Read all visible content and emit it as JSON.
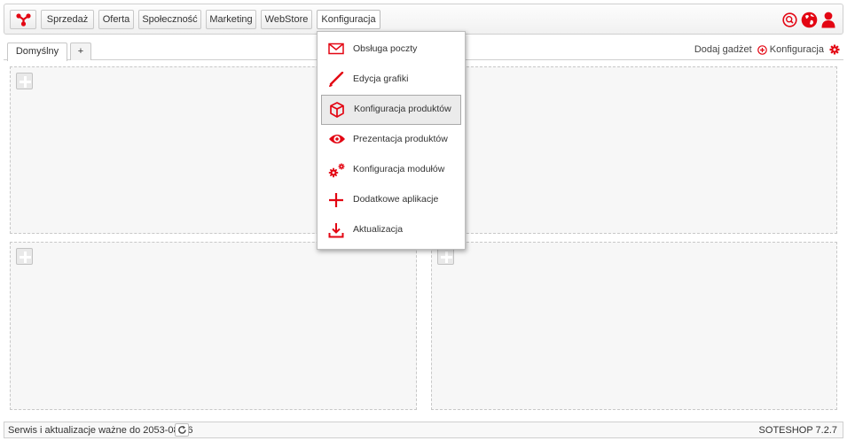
{
  "colors": {
    "accent": "#e30613",
    "border": "#cfcfcf",
    "panel": "#f7f7f7"
  },
  "nav": {
    "logo_icon": "soteshop-logo-icon",
    "items": [
      {
        "label": "Sprzedaż"
      },
      {
        "label": "Oferta"
      },
      {
        "label": "Społeczność"
      },
      {
        "label": "Marketing"
      },
      {
        "label": "WebStore"
      },
      {
        "label": "Konfiguracja",
        "active": true
      }
    ],
    "icons": [
      "search-icon",
      "globe-icon",
      "user-icon"
    ]
  },
  "tabs": {
    "items": [
      {
        "label": "Domyślny",
        "active": true
      },
      {
        "label": "+"
      }
    ],
    "add_gadget": "Dodaj gadżet",
    "config": "Konfiguracja"
  },
  "dropdown": {
    "items": [
      {
        "label": "Obsługa poczty",
        "icon": "envelope-icon"
      },
      {
        "label": "Edycja grafiki",
        "icon": "brush-icon"
      },
      {
        "label": "Konfiguracja produktów",
        "icon": "box-icon",
        "highlighted": true
      },
      {
        "label": "Prezentacja produktów",
        "icon": "eye-icon"
      },
      {
        "label": "Konfiguracja modułów",
        "icon": "gears-icon"
      },
      {
        "label": "Dodatkowe aplikacje",
        "icon": "plus-icon"
      },
      {
        "label": "Aktualizacja",
        "icon": "download-icon"
      }
    ]
  },
  "status": {
    "text": "Serwis i aktualizacje ważne do 2053-08-26",
    "version": "SOTESHOP 7.2.7"
  }
}
